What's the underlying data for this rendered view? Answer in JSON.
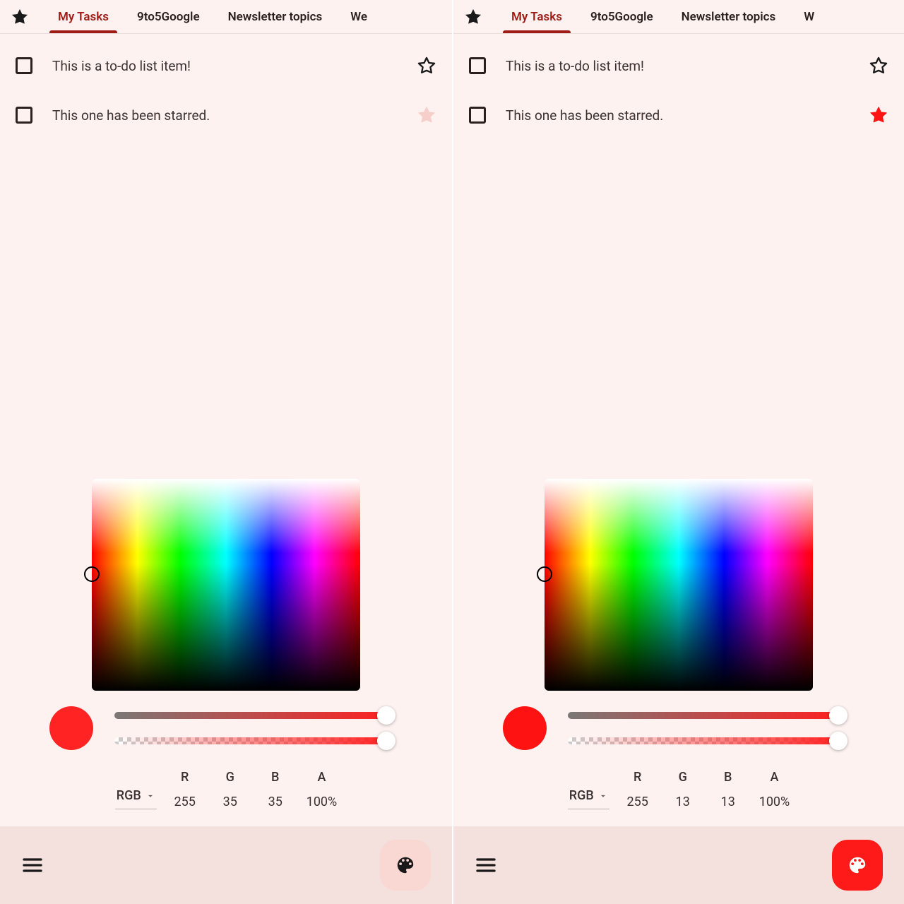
{
  "panels": [
    {
      "tabs": [
        "My Tasks",
        "9to5Google",
        "Newsletter topics",
        "We"
      ],
      "active_tab": 0,
      "tasks": [
        {
          "text": "This is a to-do list item!",
          "star_fill": "none",
          "star_stroke": "#1a1a1a"
        },
        {
          "text": "This one has been starred.",
          "star_fill": "#f6cfcb",
          "star_stroke": "#f6cfcb"
        }
      ],
      "picker": {
        "swatch": "#ff2323",
        "mode": "RGB",
        "channels": [
          {
            "lbl": "R",
            "val": "255"
          },
          {
            "lbl": "G",
            "val": "35"
          },
          {
            "lbl": "B",
            "val": "35"
          },
          {
            "lbl": "A",
            "val": "100%"
          }
        ]
      },
      "fab_style": "light",
      "fab_icon_color": "#1a1a1a"
    },
    {
      "tabs": [
        "My Tasks",
        "9to5Google",
        "Newsletter topics",
        "W"
      ],
      "active_tab": 0,
      "tasks": [
        {
          "text": "This is a to-do list item!",
          "star_fill": "none",
          "star_stroke": "#1a1a1a"
        },
        {
          "text": "This one has been starred.",
          "star_fill": "#ff1212",
          "star_stroke": "#ff1212"
        }
      ],
      "picker": {
        "swatch": "#ff1212",
        "mode": "RGB",
        "channels": [
          {
            "lbl": "R",
            "val": "255"
          },
          {
            "lbl": "G",
            "val": "13"
          },
          {
            "lbl": "B",
            "val": "13"
          },
          {
            "lbl": "A",
            "val": "100%"
          }
        ]
      },
      "fab_style": "red",
      "fab_icon_color": "#ffffff"
    }
  ]
}
